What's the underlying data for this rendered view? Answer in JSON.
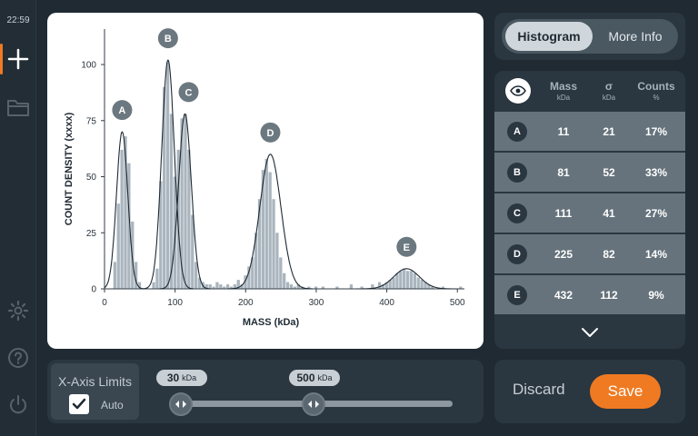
{
  "status_bar": {
    "time": "22:59"
  },
  "sidebar": {
    "items": [
      {
        "icon": "plus-icon",
        "active": true
      },
      {
        "icon": "folder-icon",
        "active": false
      },
      {
        "icon": "gear-icon",
        "active": false
      },
      {
        "icon": "help-icon",
        "active": false
      },
      {
        "icon": "power-icon",
        "active": false
      }
    ]
  },
  "chart_data": {
    "type": "bar",
    "xlabel": "MASS (kDa)",
    "ylabel": "COUNT DENSITY (xxxx)",
    "xlim": [
      0,
      510
    ],
    "ylim": [
      0,
      115
    ],
    "xticks": [
      0,
      100,
      200,
      300,
      400,
      500
    ],
    "yticks": [
      0,
      25,
      50,
      75,
      100
    ],
    "grid": false,
    "bin_width": 5,
    "bins": [
      {
        "x": 15,
        "y": 12
      },
      {
        "x": 20,
        "y": 38
      },
      {
        "x": 25,
        "y": 62
      },
      {
        "x": 30,
        "y": 68
      },
      {
        "x": 35,
        "y": 56
      },
      {
        "x": 40,
        "y": 30
      },
      {
        "x": 45,
        "y": 12
      },
      {
        "x": 50,
        "y": 3
      },
      {
        "x": 70,
        "y": 3
      },
      {
        "x": 75,
        "y": 9
      },
      {
        "x": 80,
        "y": 48
      },
      {
        "x": 85,
        "y": 90
      },
      {
        "x": 90,
        "y": 101
      },
      {
        "x": 95,
        "y": 78
      },
      {
        "x": 100,
        "y": 50
      },
      {
        "x": 105,
        "y": 62
      },
      {
        "x": 110,
        "y": 76
      },
      {
        "x": 115,
        "y": 78
      },
      {
        "x": 120,
        "y": 62
      },
      {
        "x": 125,
        "y": 33
      },
      {
        "x": 130,
        "y": 12
      },
      {
        "x": 135,
        "y": 5
      },
      {
        "x": 140,
        "y": 3
      },
      {
        "x": 145,
        "y": 2
      },
      {
        "x": 150,
        "y": 2
      },
      {
        "x": 155,
        "y": 1
      },
      {
        "x": 160,
        "y": 3
      },
      {
        "x": 165,
        "y": 2
      },
      {
        "x": 170,
        "y": 1
      },
      {
        "x": 175,
        "y": 2
      },
      {
        "x": 180,
        "y": 1
      },
      {
        "x": 185,
        "y": 2
      },
      {
        "x": 190,
        "y": 4
      },
      {
        "x": 195,
        "y": 2
      },
      {
        "x": 200,
        "y": 6
      },
      {
        "x": 205,
        "y": 10
      },
      {
        "x": 210,
        "y": 14
      },
      {
        "x": 215,
        "y": 25
      },
      {
        "x": 220,
        "y": 40
      },
      {
        "x": 225,
        "y": 53
      },
      {
        "x": 230,
        "y": 58
      },
      {
        "x": 235,
        "y": 52
      },
      {
        "x": 240,
        "y": 40
      },
      {
        "x": 245,
        "y": 25
      },
      {
        "x": 250,
        "y": 14
      },
      {
        "x": 255,
        "y": 7
      },
      {
        "x": 260,
        "y": 3
      },
      {
        "x": 265,
        "y": 2
      },
      {
        "x": 270,
        "y": 1
      },
      {
        "x": 275,
        "y": 2
      },
      {
        "x": 280,
        "y": 1
      },
      {
        "x": 290,
        "y": 1
      },
      {
        "x": 300,
        "y": 1
      },
      {
        "x": 310,
        "y": 1
      },
      {
        "x": 330,
        "y": 1
      },
      {
        "x": 350,
        "y": 2
      },
      {
        "x": 365,
        "y": 1
      },
      {
        "x": 380,
        "y": 2
      },
      {
        "x": 390,
        "y": 3
      },
      {
        "x": 395,
        "y": 2
      },
      {
        "x": 400,
        "y": 3
      },
      {
        "x": 405,
        "y": 4
      },
      {
        "x": 410,
        "y": 5
      },
      {
        "x": 415,
        "y": 7
      },
      {
        "x": 420,
        "y": 8
      },
      {
        "x": 425,
        "y": 9
      },
      {
        "x": 430,
        "y": 8
      },
      {
        "x": 435,
        "y": 8
      },
      {
        "x": 440,
        "y": 7
      },
      {
        "x": 445,
        "y": 5
      },
      {
        "x": 450,
        "y": 4
      },
      {
        "x": 455,
        "y": 3
      },
      {
        "x": 460,
        "y": 2
      },
      {
        "x": 465,
        "y": 1
      },
      {
        "x": 480,
        "y": 1
      },
      {
        "x": 505,
        "y": 1
      }
    ],
    "fits": [
      {
        "label": "A",
        "center": 25,
        "sigma": 8,
        "amplitude": 70
      },
      {
        "label": "B",
        "center": 90,
        "sigma": 9,
        "amplitude": 102
      },
      {
        "label": "C",
        "center": 114,
        "sigma": 9,
        "amplitude": 78
      },
      {
        "label": "D",
        "center": 235,
        "sigma": 15,
        "amplitude": 60
      },
      {
        "label": "E",
        "center": 428,
        "sigma": 18,
        "amplitude": 9
      }
    ],
    "bar_color": "#aab5be",
    "fit_color": "#1f2a33"
  },
  "axis_limits": {
    "title": "X-Axis Limits",
    "auto_label": "Auto",
    "auto_checked": true,
    "min_value": "30",
    "max_value": "500",
    "unit": "kDa",
    "min_fraction": 0.0,
    "max_fraction": 0.49
  },
  "segmented": {
    "histogram_label": "Histogram",
    "more_info_label": "More Info"
  },
  "table": {
    "columns": [
      {
        "label": "Mass",
        "sub": "kDa"
      },
      {
        "label": "σ",
        "sub": "kDa"
      },
      {
        "label": "Counts",
        "sub": "%"
      }
    ],
    "rows": [
      {
        "id": "A",
        "mass": "11",
        "sigma": "21",
        "counts": "17%"
      },
      {
        "id": "B",
        "mass": "81",
        "sigma": "52",
        "counts": "33%"
      },
      {
        "id": "C",
        "mass": "111",
        "sigma": "41",
        "counts": "27%"
      },
      {
        "id": "D",
        "mass": "225",
        "sigma": "82",
        "counts": "14%"
      },
      {
        "id": "E",
        "mass": "432",
        "sigma": "112",
        "counts": "9%"
      }
    ]
  },
  "actions": {
    "discard_label": "Discard",
    "save_label": "Save"
  },
  "colors": {
    "accent": "#f07a22",
    "panel": "#2a3640",
    "background": "#1f2a33",
    "row": "#66737c"
  }
}
